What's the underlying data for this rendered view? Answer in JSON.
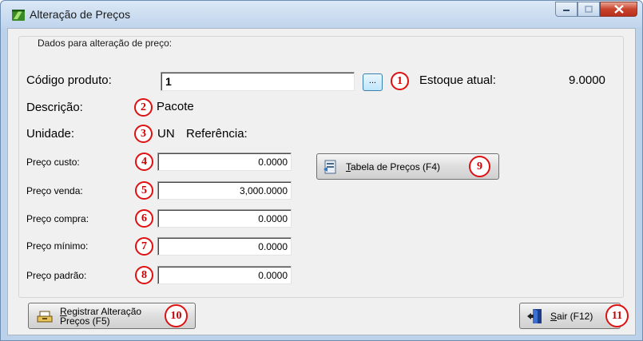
{
  "window": {
    "title": "Alteração de Preços"
  },
  "group": {
    "title": "Dados para alteração de preço:"
  },
  "product": {
    "code_label": "Código produto:",
    "code_value": "1",
    "lookup_label": "...",
    "stock_label": "Estoque atual:",
    "stock_value": "9.0000",
    "description_label": "Descrição:",
    "description_value": "Pacote",
    "unit_label": "Unidade:",
    "unit_value": "UN",
    "reference_label": "Referência:"
  },
  "prices": [
    {
      "label": "Preço custo:",
      "value": "0.0000"
    },
    {
      "label": "Preço venda:",
      "value": "3,000.0000"
    },
    {
      "label": "Preço compra:",
      "value": "0.0000"
    },
    {
      "label": "Preço mínimo:",
      "value": "0.0000"
    },
    {
      "label": "Preço padrão:",
      "value": "0.0000"
    }
  ],
  "buttons": {
    "price_table_accel": "T",
    "price_table_rest": "abela de Preços (F4)",
    "register_accel": "R",
    "register_line1_rest": "egistrar Alteração",
    "register_line2": "Preços (F5)",
    "exit_accel": "S",
    "exit_rest": "air (F12)"
  },
  "annotations": [
    "1",
    "2",
    "3",
    "4",
    "5",
    "6",
    "7",
    "8",
    "9",
    "10",
    "11"
  ],
  "colors": {
    "annotation": "#d11111",
    "titlebar": "#c9dcf1",
    "close_button": "#c8432c",
    "dialog_bg": "#f0f0f0"
  },
  "icons": [
    "app-icon",
    "minimize-icon",
    "maximize-icon",
    "close-icon",
    "price-table-icon",
    "register-icon",
    "exit-door-icon"
  ]
}
